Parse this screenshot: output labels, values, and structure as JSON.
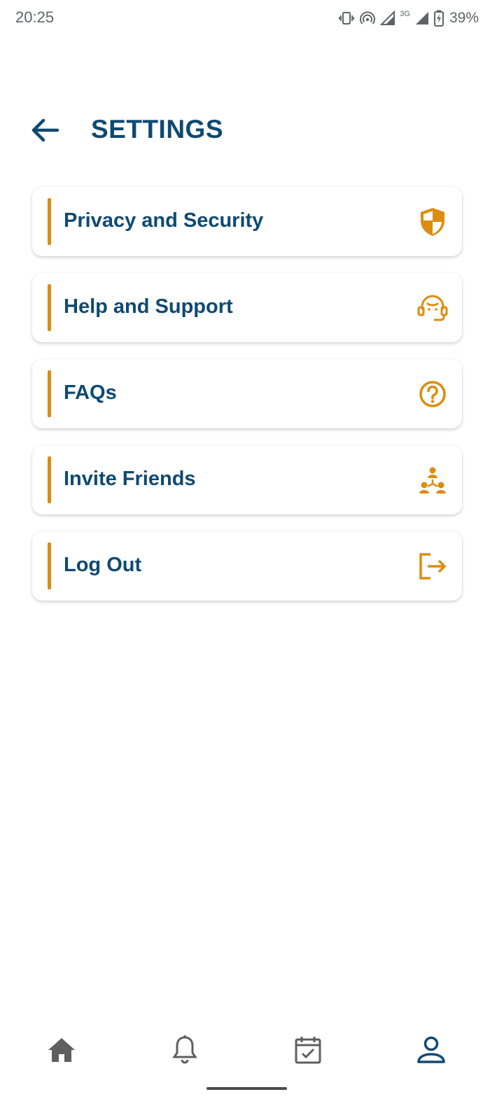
{
  "status_bar": {
    "time": "20:25",
    "network_type": "3G",
    "battery_percent": "39%",
    "icons": [
      "vibrate-icon",
      "hotspot-icon",
      "signal-icon",
      "signal-icon",
      "battery-charging-icon"
    ]
  },
  "header": {
    "title": "SETTINGS",
    "back_icon": "arrow-left-icon"
  },
  "settings": {
    "items": [
      {
        "label": "Privacy and Security",
        "icon": "shield-icon"
      },
      {
        "label": "Help and Support",
        "icon": "headset-support-icon"
      },
      {
        "label": "FAQs",
        "icon": "question-circle-icon"
      },
      {
        "label": "Invite Friends",
        "icon": "people-network-icon"
      },
      {
        "label": "Log Out",
        "icon": "logout-icon"
      }
    ]
  },
  "bottom_nav": {
    "items": [
      {
        "id": "home",
        "icon": "home-icon",
        "active": false
      },
      {
        "id": "notifications",
        "icon": "bell-icon",
        "active": false
      },
      {
        "id": "calendar",
        "icon": "calendar-check-icon",
        "active": false
      },
      {
        "id": "profile",
        "icon": "person-icon",
        "active": true
      }
    ]
  },
  "colors": {
    "primary": "#0e4a72",
    "accent": "#dc8c0e",
    "nav_inactive": "#5f5f5f",
    "status_text": "#5f6368"
  }
}
